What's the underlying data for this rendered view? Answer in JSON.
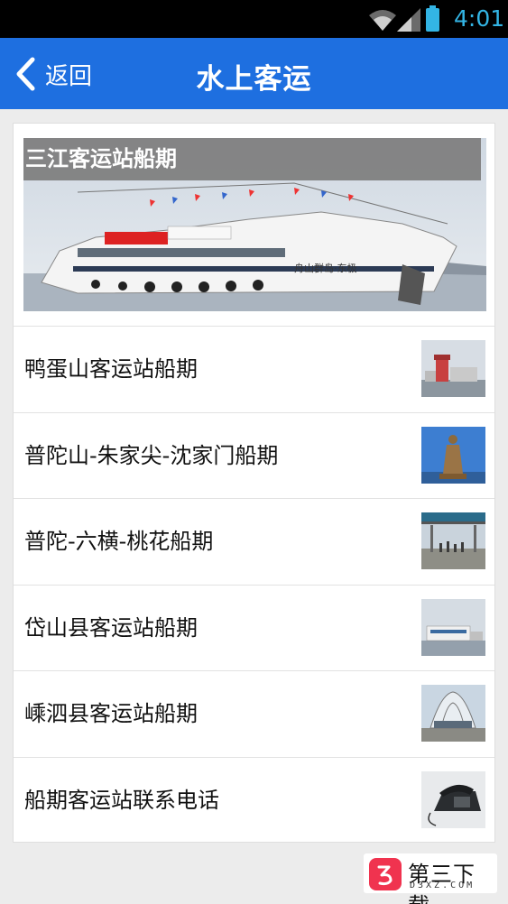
{
  "status_bar": {
    "time": "4:01",
    "time_color": "#33b5e5",
    "icons": [
      "wifi-icon",
      "signal-icon",
      "battery-icon"
    ]
  },
  "header": {
    "back_label": "返回",
    "title": "水上客运",
    "background": "#1e6fe0"
  },
  "featured": {
    "title": "三江客运站船期",
    "ship_text": "舟山群岛·东极"
  },
  "list": [
    {
      "label": "鸭蛋山客运站船期",
      "thumb": "harbor-building"
    },
    {
      "label": "普陀山-朱家尖-沈家门船期",
      "thumb": "guanyin-statue"
    },
    {
      "label": "普陀-六横-桃花船期",
      "thumb": "pier-crowd"
    },
    {
      "label": "岱山县客运站船期",
      "thumb": "port-building"
    },
    {
      "label": "嵊泗县客运站船期",
      "thumb": "arched-terminal"
    },
    {
      "label": "船期客运站联系电话",
      "thumb": "telephone"
    }
  ],
  "watermark": {
    "name": "第三下载",
    "domain": "D3XZ.COM"
  }
}
